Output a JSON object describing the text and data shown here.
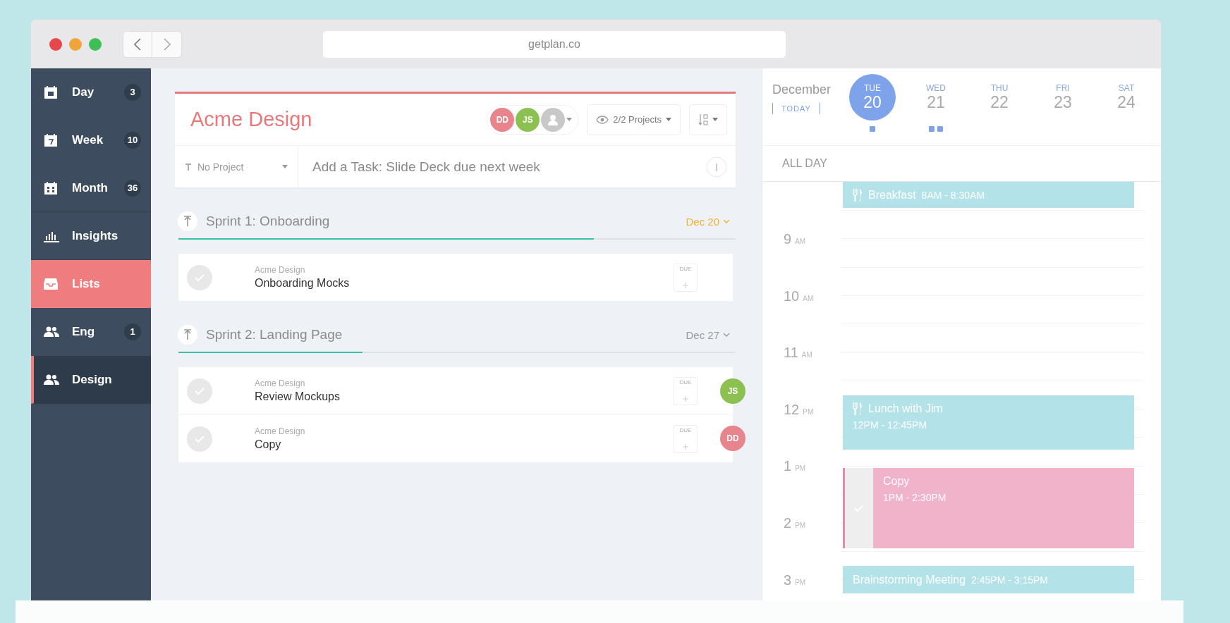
{
  "browser": {
    "url": "getplan.co"
  },
  "sidebar": {
    "items": [
      {
        "kind": "day",
        "label": "Day",
        "count": "3",
        "selected": false
      },
      {
        "kind": "week",
        "label": "Week",
        "count": "10",
        "selected": false
      },
      {
        "kind": "month",
        "label": "Month",
        "count": "36",
        "selected": false
      },
      {
        "kind": "insights",
        "label": "Insights",
        "selected": false
      },
      {
        "kind": "lists",
        "label": "Lists",
        "selected": true
      },
      {
        "kind": "team",
        "label": "Eng",
        "count": "1",
        "selected": false
      },
      {
        "kind": "team",
        "label": "Design",
        "selected": true
      }
    ]
  },
  "project": {
    "title": "Acme Design",
    "members": [
      {
        "kind": "initials",
        "initials": "DD",
        "color": "#e8848c"
      },
      {
        "kind": "initials",
        "initials": "JS",
        "color": "#8cc152"
      },
      {
        "kind": "unknown"
      }
    ],
    "filter": "2/2 Projects"
  },
  "new_task": {
    "project": "No Project",
    "placeholder": "Add a Task: Slide Deck due next week"
  },
  "sprints": [
    {
      "title": "Sprint 1: Onboarding",
      "due": "Dec 20",
      "due_today": true,
      "level": 0.745,
      "tasks": [
        {
          "project": "Acme Design",
          "title": "Onboarding Mocks",
          "checked": false,
          "due_label": "DUE"
        }
      ]
    },
    {
      "title": "Sprint 2: Landing Page",
      "due": "Dec 27",
      "due_today": false,
      "level": 0.33,
      "tasks": [
        {
          "project": "Acme Design",
          "title": "Review Mockups",
          "checked": false,
          "due_label": "DUE",
          "assignee": {
            "initials": "JS",
            "color": "#8cc152"
          }
        },
        {
          "project": "Acme Design",
          "title": "Copy",
          "checked": false,
          "due_label": "DUE",
          "assignee": {
            "initials": "DD",
            "color": "#e8848c"
          }
        }
      ]
    }
  ],
  "calendar": {
    "month": "December",
    "today_button": "TODAY",
    "days": [
      {
        "weekday": "TUE",
        "date": "20",
        "selected": true,
        "dots": [
          {
            "color": "#7ea3ea"
          }
        ]
      },
      {
        "weekday": "WED",
        "date": "21",
        "selected": false,
        "dots": [
          {
            "color": "#7ea3ea"
          },
          {
            "color": "#7ea3ea"
          }
        ]
      },
      {
        "weekday": "THU",
        "date": "22",
        "selected": false
      },
      {
        "weekday": "FRI",
        "date": "23",
        "selected": false
      },
      {
        "weekday": "SAT",
        "date": "24",
        "selected": false
      }
    ],
    "all_day_label": "ALL DAY",
    "hours": [
      {
        "hour": "9",
        "period": "AM"
      },
      {
        "hour": "10",
        "period": "AM"
      },
      {
        "hour": "11",
        "period": "AM"
      },
      {
        "hour": "12",
        "period": "PM"
      },
      {
        "hour": "1",
        "period": "PM"
      },
      {
        "hour": "2",
        "period": "PM"
      },
      {
        "hour": "3",
        "period": "PM"
      }
    ],
    "events": [
      {
        "kind": "meal",
        "title": "Breakfast",
        "time": "8AM - 8:30AM",
        "color": "#b3e2e8"
      },
      {
        "kind": "meal",
        "title": "Lunch with Jim",
        "time": "12PM - 12:45PM",
        "color": "#b3e2e8"
      },
      {
        "kind": "task",
        "title": "Copy",
        "time": "1PM - 2:30PM",
        "color": "#f0b3ca"
      },
      {
        "kind": "meeting",
        "title": "Brainstorming Meeting",
        "time": "2:45PM - 3:15PM",
        "color": "#b3e2e8"
      }
    ]
  }
}
